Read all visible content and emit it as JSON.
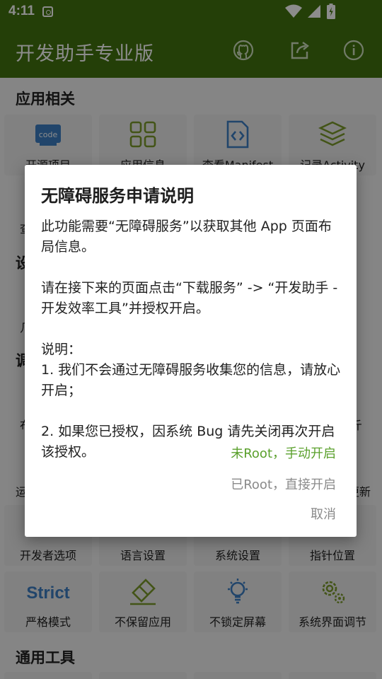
{
  "status_bar": {
    "time": "4:11",
    "icons": [
      "screenshot-icon",
      "wifi-icon",
      "signal-icon",
      "battery-icon"
    ]
  },
  "app_bar": {
    "title": "开发助手专业版",
    "actions": [
      "github-icon",
      "share-icon",
      "info-icon"
    ],
    "color": "#42740f"
  },
  "sections": [
    {
      "title": "应用相关",
      "tiles": [
        {
          "label": "开源项目",
          "icon": "code-icon"
        },
        {
          "label": "应用信息",
          "icon": "grid-icon"
        },
        {
          "label": "查看Manifest",
          "icon": "file-code-icon"
        },
        {
          "label": "记录Activity",
          "icon": "layers-icon"
        }
      ]
    },
    {
      "title": "",
      "tiles": [
        {
          "label": "开发者选项",
          "icon": "developer-options-icon"
        },
        {
          "label": "语言设置",
          "icon": "language-icon"
        },
        {
          "label": "系统设置",
          "icon": "settings-icon"
        },
        {
          "label": "指针位置",
          "icon": "pointer-icon"
        }
      ]
    },
    {
      "title": "",
      "tiles": [
        {
          "label": "严格模式",
          "icon": "strict-icon",
          "icon_text": "Strict"
        },
        {
          "label": "不保留应用",
          "icon": "eraser-icon"
        },
        {
          "label": "不锁定屏幕",
          "icon": "bulb-icon"
        },
        {
          "label": "系统界面调节",
          "icon": "gears-icon"
        }
      ]
    },
    {
      "title": "通用工具",
      "tiles": []
    }
  ],
  "partial_text": {
    "left_1": "查",
    "left_2": "设",
    "left_3": "几",
    "left_4": "调",
    "left_5": "布",
    "left_6": "运",
    "right_1": "斤",
    "right_2": "更新"
  },
  "dialog": {
    "title": "无障碍服务申请说明",
    "paragraphs": [
      "此功能需要“无障碍服务”以获取其他 App 页面布局信息。",
      "请在接下来的页面点击“下载服务” -> “开发助手 - 开发效率工具”并授权开启。",
      "说明：\n1. 我们不会通过无障碍服务收集您的信息，请放心开启；",
      "2. 如果您已授权，因系统 Bug 请先关闭再次开启该授权。"
    ],
    "buttons": {
      "manual": "未Root，手动开启",
      "root": "已Root，直接开启",
      "cancel": "取消"
    },
    "colors": {
      "manual": "#5aa02c",
      "root": "#8a8a8a",
      "cancel": "#8a8a8a"
    }
  }
}
